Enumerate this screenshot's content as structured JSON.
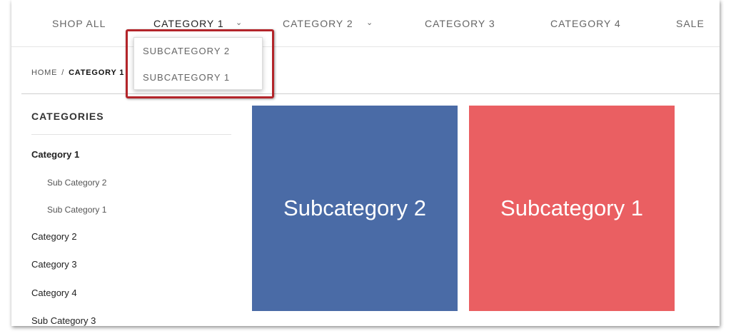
{
  "nav": {
    "items": [
      {
        "label": "SHOP ALL"
      },
      {
        "label": "CATEGORY 1"
      },
      {
        "label": "CATEGORY 2"
      },
      {
        "label": "CATEGORY 3"
      },
      {
        "label": "CATEGORY 4"
      },
      {
        "label": "SALE"
      }
    ],
    "chevron_icon": "chevron-down-icon"
  },
  "dropdown": {
    "items": [
      {
        "label": "SUBCATEGORY 2"
      },
      {
        "label": "SUBCATEGORY 1"
      }
    ],
    "highlight_color": "#b3252a"
  },
  "breadcrumb": {
    "home": "HOME",
    "separator": "/",
    "current": "CATEGORY 1"
  },
  "sidebar": {
    "title": "CATEGORIES",
    "items": [
      {
        "label": "Category 1"
      },
      {
        "label": "Sub Category 2"
      },
      {
        "label": "Sub Category 1"
      },
      {
        "label": "Category 2"
      },
      {
        "label": "Category 3"
      },
      {
        "label": "Category 4"
      },
      {
        "label": "Sub Category 3"
      }
    ]
  },
  "tiles": [
    {
      "label": "Subcategory 2",
      "color": "#4a6ba6"
    },
    {
      "label": "Subcategory 1",
      "color": "#ea5f62"
    }
  ]
}
